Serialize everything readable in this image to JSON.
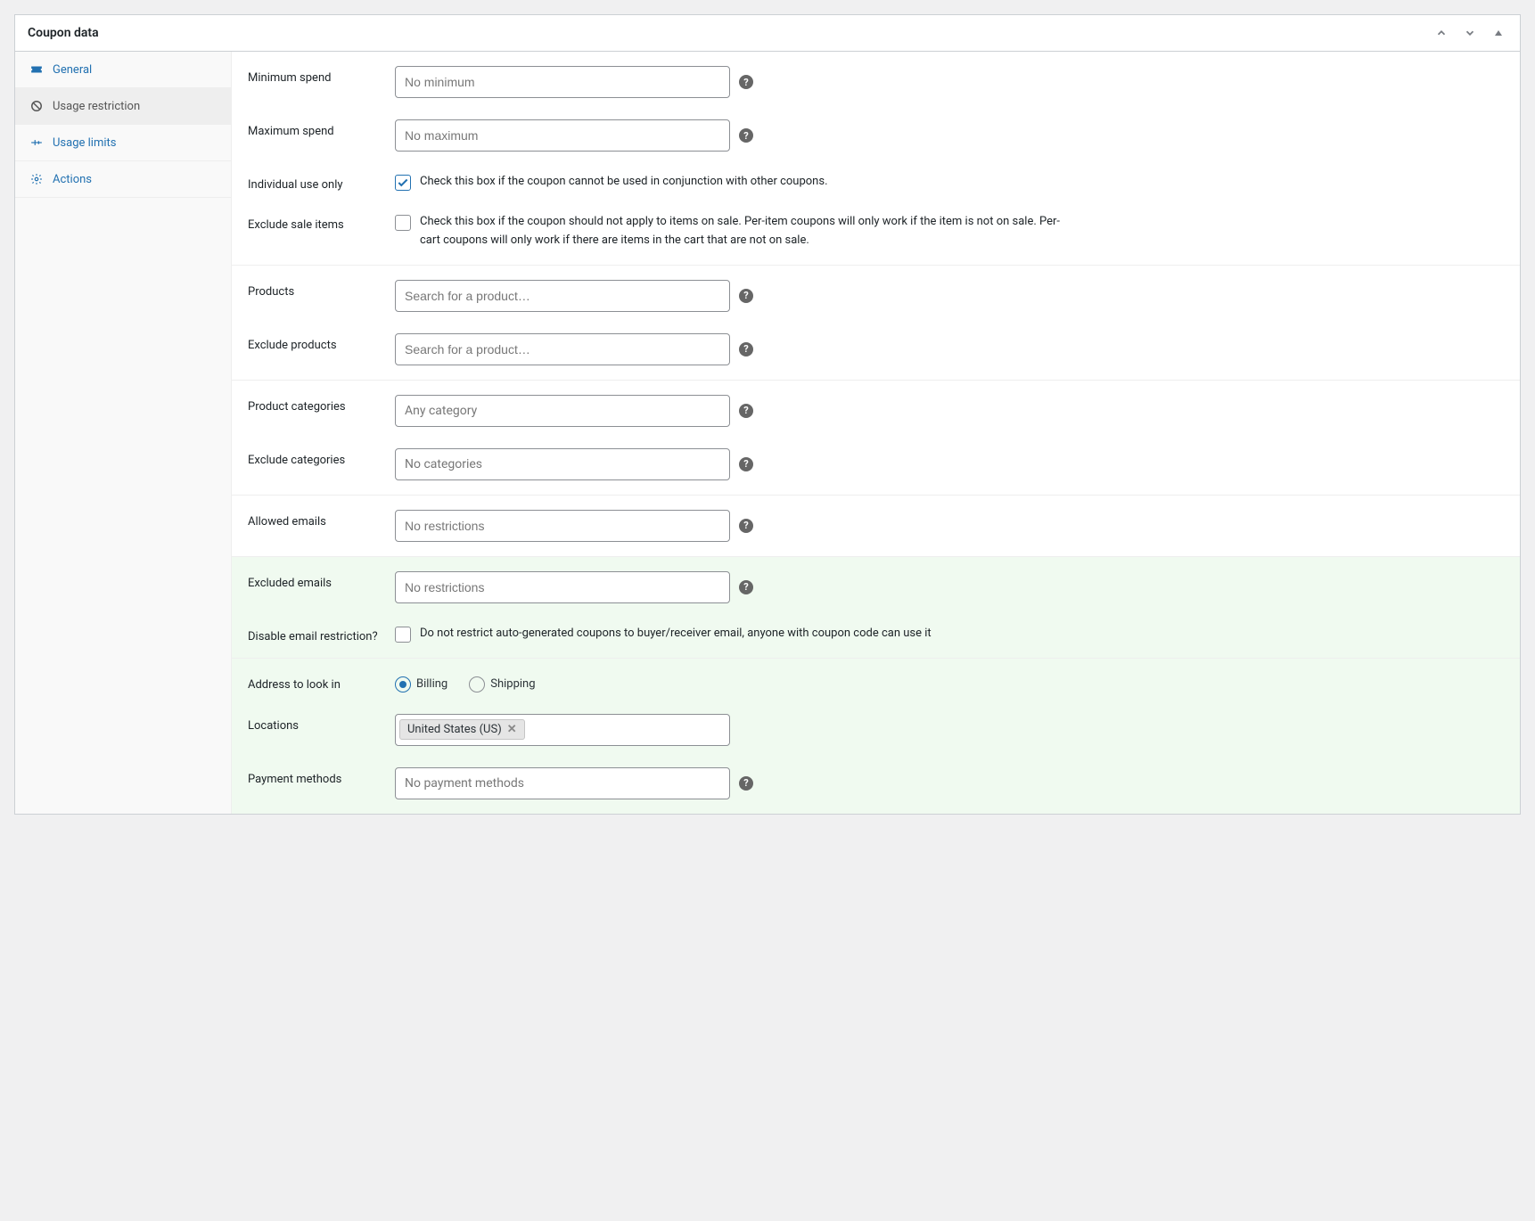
{
  "panel": {
    "title": "Coupon data"
  },
  "tabs": [
    {
      "key": "general",
      "label": "General"
    },
    {
      "key": "usage-restriction",
      "label": "Usage restriction"
    },
    {
      "key": "usage-limits",
      "label": "Usage limits"
    },
    {
      "key": "actions",
      "label": "Actions"
    }
  ],
  "fields": {
    "minimum_spend": {
      "label": "Minimum spend",
      "placeholder": "No minimum"
    },
    "maximum_spend": {
      "label": "Maximum spend",
      "placeholder": "No maximum"
    },
    "individual_use": {
      "label": "Individual use only",
      "text": "Check this box if the coupon cannot be used in conjunction with other coupons.",
      "checked": true
    },
    "exclude_sale": {
      "label": "Exclude sale items",
      "text": "Check this box if the coupon should not apply to items on sale. Per-item coupons will only work if the item is not on sale. Per-cart coupons will only work if there are items in the cart that are not on sale.",
      "checked": false
    },
    "products": {
      "label": "Products",
      "placeholder": "Search for a product…"
    },
    "exclude_products": {
      "label": "Exclude products",
      "placeholder": "Search for a product…"
    },
    "product_categories": {
      "label": "Product categories",
      "placeholder": "Any category"
    },
    "exclude_categories": {
      "label": "Exclude categories",
      "placeholder": "No categories"
    },
    "allowed_emails": {
      "label": "Allowed emails",
      "placeholder": "No restrictions"
    },
    "excluded_emails": {
      "label": "Excluded emails",
      "placeholder": "No restrictions"
    },
    "disable_email_restriction": {
      "label": "Disable email restriction?",
      "text": "Do not restrict auto-generated coupons to buyer/receiver email, anyone with coupon code can use it",
      "checked": false
    },
    "address_to_look": {
      "label": "Address to look in",
      "options": {
        "billing": "Billing",
        "shipping": "Shipping"
      },
      "selected": "billing"
    },
    "locations": {
      "label": "Locations",
      "tag": "United States (US)"
    },
    "payment_methods": {
      "label": "Payment methods",
      "placeholder": "No payment methods"
    }
  }
}
